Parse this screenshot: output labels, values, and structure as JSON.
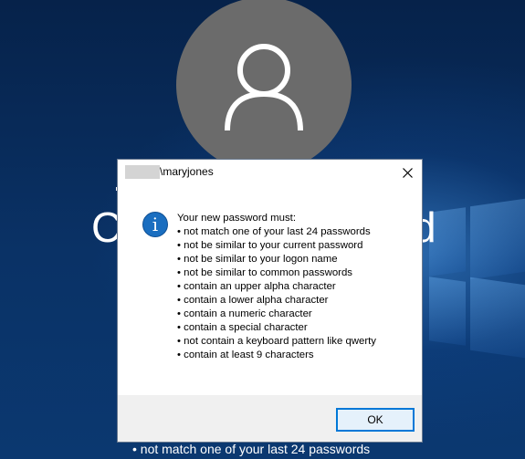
{
  "background": {
    "heading_left": "C",
    "heading_right": "d",
    "bottom_rule": "• not match one of your last 24 passwords"
  },
  "dialog": {
    "title_user": "\\maryjones",
    "message_intro": "Your new password must:",
    "rules": [
      "• not match one of your last 24 passwords",
      "• not be similar to your current password",
      "• not be similar to your logon name",
      "• not be similar to common passwords",
      "• contain an upper alpha character",
      "• contain a lower alpha character",
      "• contain a numeric character",
      "• contain a special character",
      "• not contain a keyboard pattern like qwerty",
      "• contain at least 9 characters"
    ],
    "ok_label": "OK",
    "icon": "info-icon"
  },
  "colors": {
    "accent": "#0078d7",
    "info_icon": "#1a6ec0",
    "avatar": "#6b6b6b"
  }
}
